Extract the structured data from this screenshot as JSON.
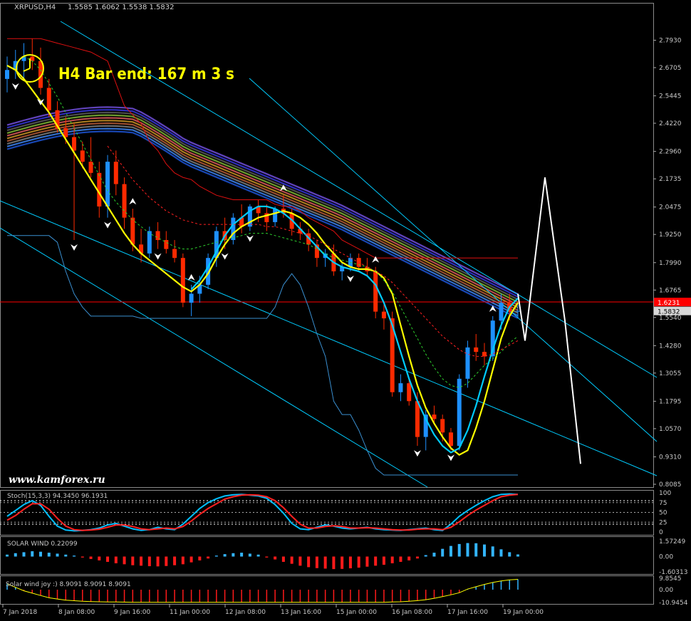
{
  "window": {
    "symbol_title": "XRPUSD,H4",
    "ohlc": "1.5585 1.6062 1.5538 1.5832",
    "bar_end": "H4 Bar end: 167 m 3 s",
    "watermark": "www.kamforex.ru"
  },
  "colors": {
    "bull": "#1e90ff",
    "bear": "#ff2a00",
    "yellow": "#ffff00",
    "cyan": "#00ccff",
    "grid": "#3a3a3a",
    "price_line": "#ff0000"
  },
  "chart_data": [
    {
      "type": "line",
      "panel": "main",
      "ylim": [
        0.8085,
        2.855
      ],
      "y_ticks": [
        "2.7930",
        "2.6705",
        "2.5445",
        "2.4220",
        "2.2960",
        "2.1735",
        "2.0475",
        "1.9250",
        "1.7990",
        "1.6765",
        "1.5540",
        "1.4280",
        "1.3055",
        "1.1795",
        "1.0570",
        "0.9310",
        "0.8085"
      ],
      "x_ticks": [
        "7 Jan 2018",
        "8 Jan 08:00",
        "9 Jan 16:00",
        "11 Jan 00:00",
        "12 Jan 08:00",
        "13 Jan 16:00",
        "15 Jan 00:00",
        "16 Jan 08:00",
        "17 Jan 16:00",
        "19 Jan 00:00"
      ],
      "price_labels": {
        "red_level": "1.6231",
        "current": "1.5832"
      },
      "candles": [
        [
          2.62,
          2.72,
          2.56,
          2.66
        ],
        [
          2.66,
          2.75,
          2.62,
          2.7
        ],
        [
          2.7,
          2.78,
          2.62,
          2.72
        ],
        [
          2.72,
          2.8,
          2.66,
          2.7
        ],
        [
          2.7,
          2.76,
          2.55,
          2.58
        ],
        [
          2.58,
          2.62,
          2.45,
          2.48
        ],
        [
          2.48,
          2.52,
          2.38,
          2.4
        ],
        [
          2.4,
          2.45,
          2.33,
          2.36
        ],
        [
          2.36,
          2.42,
          1.9,
          2.3
        ],
        [
          2.3,
          2.34,
          2.22,
          2.25
        ],
        [
          2.25,
          2.36,
          2.18,
          2.2
        ],
        [
          2.2,
          2.25,
          2.0,
          2.05
        ],
        [
          2.05,
          2.28,
          2.0,
          2.25
        ],
        [
          2.25,
          2.3,
          2.1,
          2.15
        ],
        [
          2.15,
          2.18,
          1.95,
          2.0
        ],
        [
          2.0,
          2.04,
          1.85,
          1.88
        ],
        [
          1.88,
          1.95,
          1.8,
          1.84
        ],
        [
          1.84,
          1.96,
          1.82,
          1.94
        ],
        [
          1.94,
          1.98,
          1.86,
          1.9
        ],
        [
          1.9,
          1.94,
          1.84,
          1.86
        ],
        [
          1.86,
          1.9,
          1.8,
          1.82
        ],
        [
          1.82,
          1.84,
          1.6,
          1.62
        ],
        [
          1.62,
          1.7,
          1.56,
          1.66
        ],
        [
          1.66,
          1.74,
          1.62,
          1.7
        ],
        [
          1.7,
          1.84,
          1.68,
          1.82
        ],
        [
          1.82,
          1.96,
          1.78,
          1.94
        ],
        [
          1.94,
          2.0,
          1.86,
          1.9
        ],
        [
          1.9,
          2.02,
          1.88,
          2.0
        ],
        [
          2.0,
          2.06,
          1.93,
          1.96
        ],
        [
          1.96,
          2.06,
          1.94,
          2.05
        ],
        [
          2.05,
          2.08,
          1.98,
          2.02
        ],
        [
          2.02,
          2.06,
          1.94,
          1.98
        ],
        [
          1.98,
          2.05,
          1.96,
          2.04
        ],
        [
          2.04,
          2.1,
          2.0,
          2.02
        ],
        [
          2.02,
          2.04,
          1.92,
          1.95
        ],
        [
          1.95,
          1.98,
          1.9,
          1.93
        ],
        [
          1.93,
          1.95,
          1.85,
          1.88
        ],
        [
          1.88,
          1.9,
          1.78,
          1.82
        ],
        [
          1.82,
          1.86,
          1.78,
          1.84
        ],
        [
          1.84,
          1.88,
          1.74,
          1.76
        ],
        [
          1.76,
          1.8,
          1.72,
          1.78
        ],
        [
          1.78,
          1.84,
          1.76,
          1.82
        ],
        [
          1.82,
          1.84,
          1.76,
          1.78
        ],
        [
          1.78,
          1.82,
          1.74,
          1.76
        ],
        [
          1.76,
          1.78,
          1.55,
          1.58
        ],
        [
          1.58,
          1.62,
          1.5,
          1.55
        ],
        [
          1.55,
          1.58,
          1.2,
          1.22
        ],
        [
          1.22,
          1.3,
          1.18,
          1.26
        ],
        [
          1.26,
          1.28,
          1.16,
          1.18
        ],
        [
          1.18,
          1.22,
          0.98,
          1.02
        ],
        [
          1.02,
          1.14,
          0.96,
          1.12
        ],
        [
          1.12,
          1.16,
          1.08,
          1.1
        ],
        [
          1.1,
          1.12,
          1.0,
          1.04
        ],
        [
          1.04,
          1.06,
          0.96,
          0.98
        ],
        [
          0.98,
          1.3,
          0.96,
          1.28
        ],
        [
          1.28,
          1.45,
          1.24,
          1.42
        ],
        [
          1.42,
          1.48,
          1.36,
          1.4
        ],
        [
          1.4,
          1.44,
          1.34,
          1.38
        ],
        [
          1.38,
          1.56,
          1.36,
          1.54
        ],
        [
          1.54,
          1.66,
          1.5,
          1.62
        ],
        [
          1.62,
          1.66,
          1.54,
          1.58
        ],
        [
          1.58,
          1.61,
          1.55,
          1.5832
        ]
      ],
      "series": [
        {
          "name": "",
          "color": "#ffff00",
          "values": [
            2.68,
            2.66,
            2.62,
            2.57,
            2.52,
            2.47,
            2.41,
            2.35,
            2.29,
            2.23,
            2.17,
            2.11,
            2.05,
            1.99,
            1.93,
            1.88,
            1.84,
            1.81,
            1.78,
            1.75,
            1.72,
            1.69,
            1.67,
            1.7,
            1.75,
            1.82,
            1.88,
            1.93,
            1.96,
            1.98,
            2.0,
            2.01,
            2.02,
            2.03,
            2.02,
            2.0,
            1.97,
            1.93,
            1.88,
            1.84,
            1.8,
            1.78,
            1.77,
            1.77,
            1.76,
            1.73,
            1.66,
            1.52,
            1.38,
            1.25,
            1.15,
            1.08,
            1.02,
            0.97,
            0.94,
            0.96,
            1.06,
            1.18,
            1.32,
            1.46,
            1.56,
            1.62
          ]
        },
        {
          "name": "",
          "color": "#00ccff",
          "values": [
            null,
            null,
            null,
            null,
            null,
            null,
            null,
            null,
            null,
            null,
            null,
            null,
            null,
            null,
            null,
            null,
            null,
            null,
            null,
            null,
            null,
            null,
            1.68,
            1.72,
            1.78,
            1.85,
            1.92,
            1.97,
            2.0,
            2.03,
            2.05,
            2.05,
            2.04,
            2.02,
            1.99,
            1.95,
            1.91,
            1.87,
            1.83,
            1.8,
            1.78,
            1.77,
            1.76,
            1.74,
            1.7,
            1.62,
            1.52,
            1.4,
            1.28,
            1.18,
            1.1,
            1.03,
            0.98,
            0.95,
            0.97,
            1.05,
            1.16,
            1.29,
            1.41,
            1.52,
            1.6,
            1.64
          ]
        },
        {
          "name": "",
          "color": "#2ed12e",
          "values": [
            null,
            null,
            2.72,
            2.7,
            2.66,
            2.6,
            2.54,
            2.47,
            2.4,
            2.33,
            2.26,
            2.19,
            2.12,
            2.07,
            2.03,
            1.99,
            1.96,
            1.93,
            1.91,
            1.89,
            1.87,
            1.86,
            1.86,
            1.87,
            1.88,
            1.89,
            1.9,
            1.91,
            1.92,
            1.93,
            1.93,
            1.93,
            1.92,
            1.91,
            1.9,
            1.89,
            1.88,
            1.86,
            1.84,
            1.82,
            1.81,
            1.8,
            1.79,
            1.78,
            1.76,
            1.72,
            1.67,
            1.6,
            1.53,
            1.46,
            1.39,
            1.33,
            1.28,
            1.25,
            1.24,
            1.26,
            1.3,
            1.34,
            1.37,
            1.4,
            1.44,
            1.47
          ]
        },
        {
          "name": "",
          "color": "#ff2020",
          "values": [
            null,
            null,
            null,
            null,
            null,
            null,
            null,
            null,
            null,
            null,
            null,
            null,
            2.32,
            2.27,
            2.22,
            2.17,
            2.13,
            2.09,
            2.06,
            2.03,
            2.01,
            1.99,
            1.98,
            1.97,
            1.97,
            1.97,
            1.97,
            1.97,
            1.97,
            1.97,
            1.97,
            1.96,
            1.96,
            1.95,
            1.94,
            1.93,
            1.92,
            1.9,
            1.88,
            1.86,
            1.84,
            1.82,
            1.8,
            1.78,
            1.76,
            1.74,
            1.71,
            1.67,
            1.63,
            1.59,
            1.55,
            1.51,
            1.47,
            1.44,
            1.41,
            1.39,
            1.38,
            1.38,
            1.39,
            1.41,
            1.43,
            1.45
          ]
        },
        {
          "name": "",
          "color": "#dd1010",
          "values": [
            2.8,
            2.8,
            2.8,
            2.8,
            2.8,
            2.79,
            2.78,
            2.77,
            2.76,
            2.75,
            2.74,
            2.72,
            2.7,
            2.6,
            2.5,
            2.46,
            2.42,
            2.34,
            2.3,
            2.24,
            2.2,
            2.18,
            2.17,
            2.14,
            2.12,
            2.1,
            2.09,
            2.08,
            2.08,
            2.08,
            2.08,
            2.08,
            2.06,
            2.05,
            2.05,
            2.03,
            2.0,
            1.98,
            1.96,
            1.94,
            1.9,
            1.88,
            1.86,
            1.84,
            1.82,
            1.82,
            1.82,
            1.82,
            1.82,
            1.82,
            1.82,
            1.82,
            1.82,
            1.82,
            1.82,
            1.82,
            1.82,
            1.82,
            1.82,
            1.82,
            1.82,
            1.82
          ]
        },
        {
          "name": "",
          "color": "#3a8fd0",
          "values": [
            1.92,
            1.92,
            1.92,
            1.92,
            1.92,
            1.92,
            1.89,
            1.76,
            1.66,
            1.6,
            1.56,
            1.56,
            1.56,
            1.56,
            1.56,
            1.56,
            1.55,
            1.55,
            1.55,
            1.55,
            1.55,
            1.55,
            1.55,
            1.55,
            1.55,
            1.55,
            1.55,
            1.55,
            1.55,
            1.55,
            1.55,
            1.55,
            1.6,
            1.7,
            1.75,
            1.7,
            1.6,
            1.48,
            1.38,
            1.18,
            1.12,
            1.12,
            1.05,
            0.96,
            0.88,
            0.85,
            0.85,
            0.85,
            0.85,
            0.85,
            0.85,
            0.85,
            0.85,
            0.85,
            0.85,
            0.85,
            0.85,
            0.85,
            0.85,
            0.85,
            0.85,
            0.85
          ]
        }
      ],
      "projection_white": [
        1.66,
        1.45,
        2.18,
        1.54,
        0.9
      ]
    },
    {
      "type": "line",
      "panel": "stoch",
      "title": "Stoch(15,3,3) 94.3450 96.1931",
      "ylim": [
        0,
        100
      ],
      "y_ticks": [
        "100",
        "75",
        "50",
        "25",
        "0"
      ],
      "series": [
        {
          "name": "",
          "color": "#00bfff",
          "values": [
            40,
            55,
            70,
            80,
            68,
            40,
            15,
            5,
            3,
            4,
            6,
            10,
            18,
            22,
            15,
            8,
            4,
            6,
            12,
            8,
            6,
            20,
            40,
            60,
            75,
            85,
            92,
            95,
            96,
            94,
            92,
            86,
            70,
            48,
            22,
            8,
            6,
            12,
            18,
            15,
            10,
            8,
            10,
            12,
            8,
            6,
            5,
            4,
            6,
            8,
            10,
            6,
            4,
            20,
            40,
            55,
            68,
            80,
            90,
            96,
            97,
            96
          ]
        },
        {
          "name": "",
          "color": "#ff2020",
          "values": [
            30,
            42,
            58,
            72,
            72,
            58,
            35,
            15,
            6,
            4,
            5,
            7,
            12,
            18,
            18,
            14,
            8,
            6,
            8,
            10,
            8,
            14,
            28,
            45,
            60,
            72,
            84,
            90,
            94,
            95,
            94,
            90,
            80,
            62,
            40,
            20,
            10,
            10,
            14,
            16,
            14,
            10,
            10,
            11,
            10,
            8,
            6,
            5,
            5,
            7,
            8,
            8,
            6,
            12,
            26,
            42,
            56,
            68,
            80,
            90,
            94,
            96
          ]
        }
      ]
    },
    {
      "type": "bar",
      "panel": "solar_wind",
      "title": "SOLAR WIND 0.22099",
      "ylim": [
        -1.60313,
        1.57249
      ],
      "y_ticks": [
        "1.57249",
        "0.00",
        "-1.60313"
      ],
      "values": [
        0.2,
        0.35,
        0.45,
        0.55,
        0.5,
        0.4,
        0.3,
        0.2,
        0.1,
        -0.1,
        -0.25,
        -0.4,
        -0.55,
        -0.7,
        -0.8,
        -0.9,
        -0.95,
        -1.0,
        -1.02,
        -0.98,
        -0.9,
        -0.8,
        -0.6,
        -0.4,
        -0.2,
        0.1,
        0.25,
        0.35,
        0.4,
        0.3,
        0.2,
        -0.1,
        -0.3,
        -0.55,
        -0.75,
        -0.95,
        -1.1,
        -1.2,
        -1.25,
        -1.3,
        -1.28,
        -1.22,
        -1.15,
        -1.05,
        -0.95,
        -0.85,
        -0.7,
        -0.55,
        -0.4,
        -0.2,
        0.15,
        0.4,
        0.8,
        1.1,
        1.3,
        1.4,
        1.38,
        1.25,
        1.05,
        0.75,
        0.45,
        0.22
      ]
    },
    {
      "type": "bar",
      "panel": "solar_wind_joy",
      "title": "Solar wind joy :) 8.9091 8.9091 8.9091",
      "ylim": [
        -10.9454,
        9.8545
      ],
      "y_ticks": [
        "9.8545",
        "0.00",
        "-10.9454"
      ],
      "values": [
        5,
        2,
        -1,
        -3,
        -5,
        -7,
        -8,
        -9,
        -9.5,
        -10,
        -10.2,
        -10.4,
        -10.5,
        -10.6,
        -10.7,
        -10.8,
        -10.8,
        -10.9,
        -10.9,
        -10.9,
        -10.9,
        -10.9,
        -10.9,
        -10.9,
        -10.9,
        -10.9,
        -10.9,
        -10.9,
        -10.9,
        -10.9,
        -10.9,
        -10.9,
        -10.9,
        -10.9,
        -10.9,
        -10.9,
        -10.9,
        -10.9,
        -10.9,
        -10.9,
        -10.9,
        -10.9,
        -10.9,
        -10.9,
        -10.9,
        -10.8,
        -10.6,
        -10.4,
        -10,
        -9.4,
        -8.6,
        -7.4,
        -6,
        -4.4,
        -2.6,
        0.5,
        2.5,
        4.5,
        6.2,
        7.5,
        8.4,
        8.9
      ]
    }
  ]
}
